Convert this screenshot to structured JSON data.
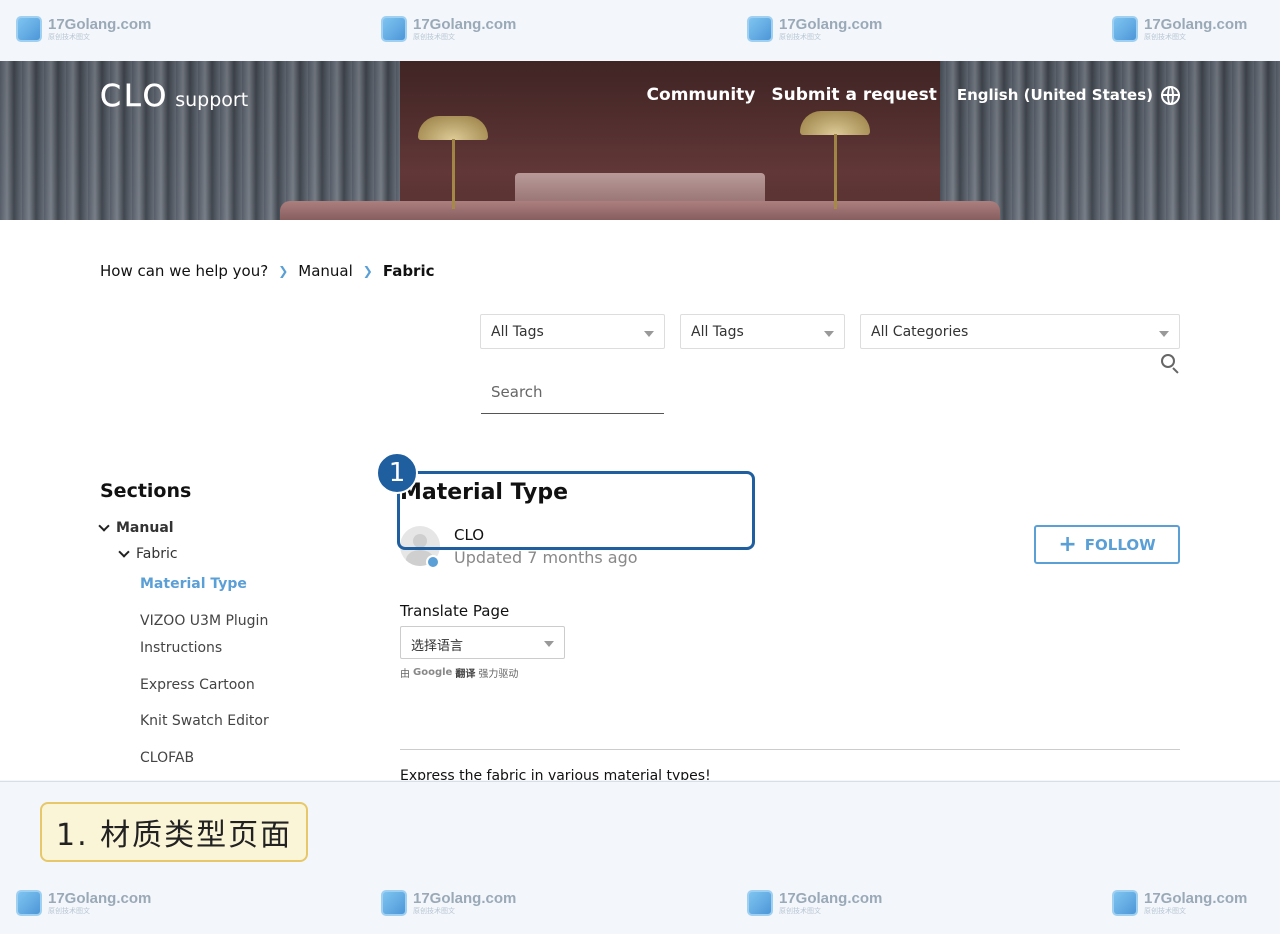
{
  "watermark": {
    "site": "17Golang.com",
    "tagline": "原创技术图文"
  },
  "header": {
    "brand_logo": "CLO",
    "brand_suffix": "support",
    "nav": [
      {
        "label": "Community"
      },
      {
        "label": "Submit a request"
      }
    ],
    "language": "English (United States)",
    "language_icon": "globe-icon"
  },
  "breadcrumb": {
    "items": [
      "How can we help you?",
      "Manual",
      "Fabric"
    ]
  },
  "filters": {
    "tags1": "All Tags",
    "tags2": "All Tags",
    "categories": "All Categories",
    "search_placeholder": "Search"
  },
  "sidebar": {
    "title": "Sections",
    "tree": [
      {
        "label": "Manual"
      },
      {
        "label": "Fabric"
      }
    ],
    "articles": [
      {
        "label": "Material Type",
        "active": true
      },
      {
        "label": "VIZOO U3M Plugin Instructions"
      },
      {
        "label": "Express Cartoon"
      },
      {
        "label": "Knit Swatch Editor"
      },
      {
        "label": "CLOFAB"
      }
    ]
  },
  "article": {
    "title": "Material Type",
    "author": "CLO",
    "updated": "Updated 7 months ago",
    "follow_label": "FOLLOW",
    "translate_label": "Translate Page",
    "language_select": "选择语言",
    "powered_prefix": "由",
    "powered_brand": "Google",
    "powered_translate": "翻译",
    "powered_suffix": "强力驱动",
    "intro": "Express the fabric in various material types!"
  },
  "annotation": {
    "step": "1",
    "caption": "1. 材质类型页面",
    "color": "#1f5f9f"
  },
  "colors": {
    "accent": "#5a9fd6"
  }
}
